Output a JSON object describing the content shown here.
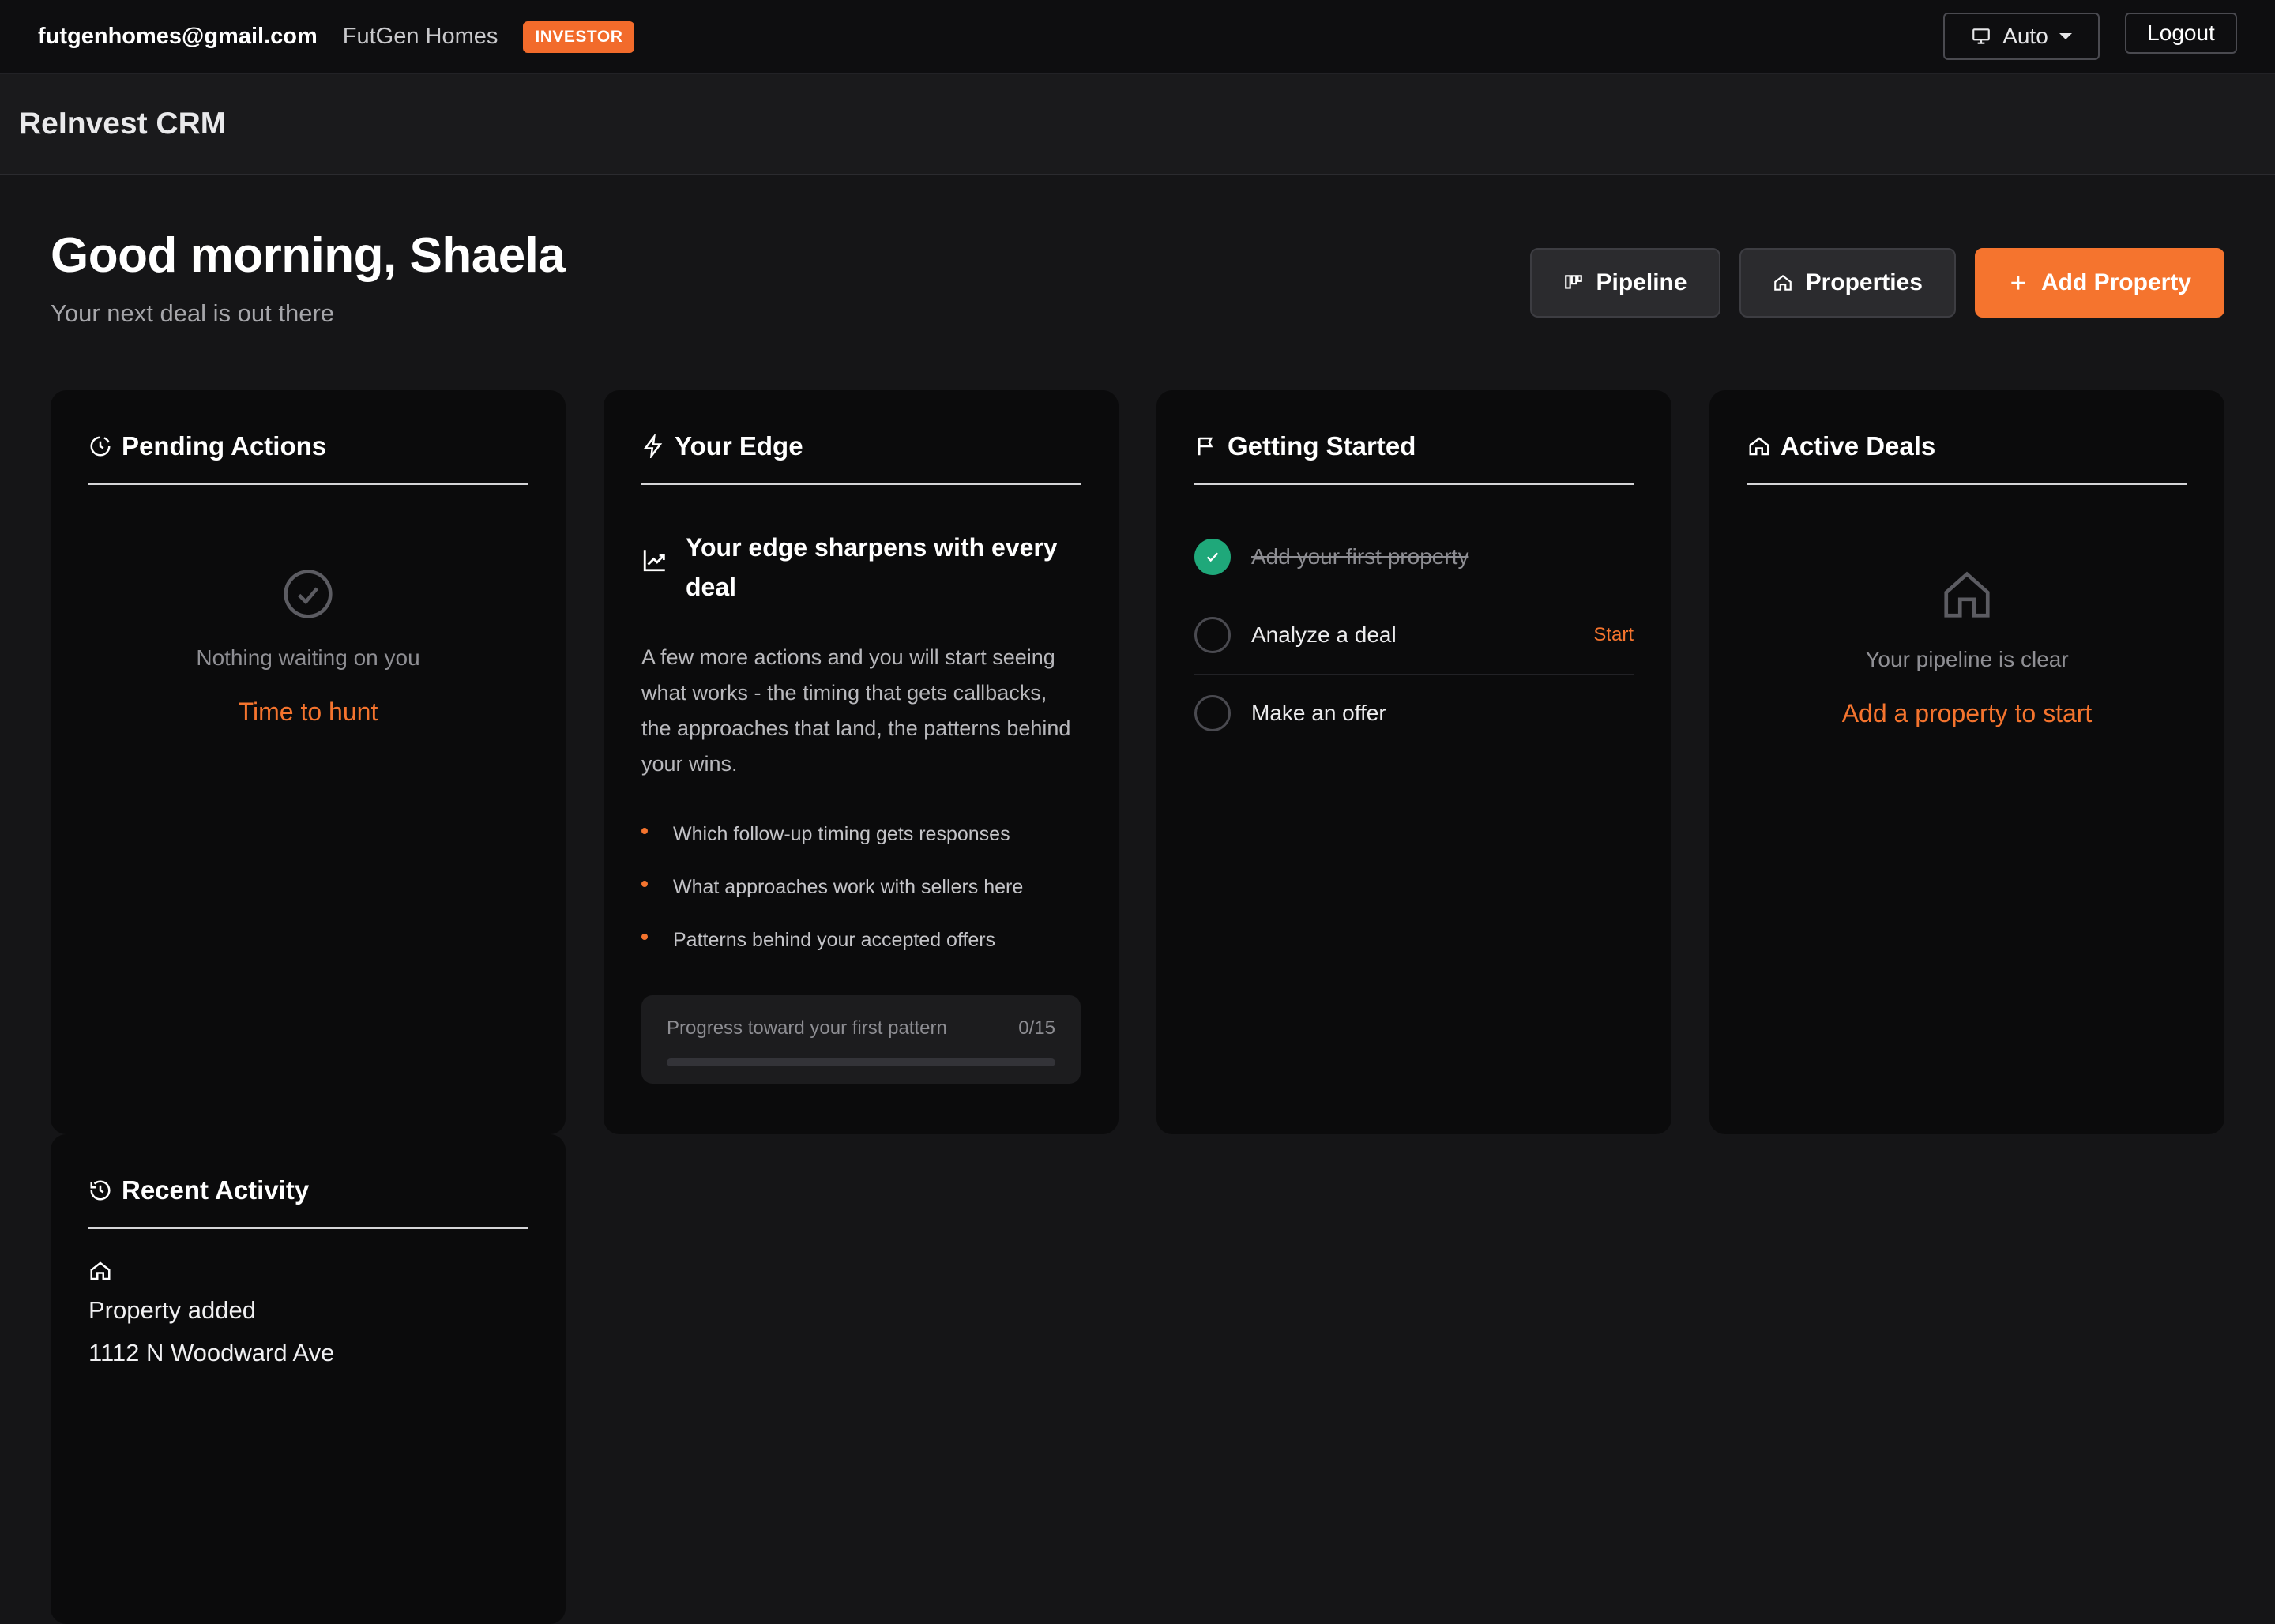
{
  "topbar": {
    "email": "futgenhomes@gmail.com",
    "company": "FutGen Homes",
    "role_badge": "INVESTOR",
    "theme": "Auto",
    "logout": "Logout"
  },
  "app": {
    "title": "ReInvest CRM"
  },
  "greeting": {
    "title": "Good morning, Shaela",
    "subtitle": "Your next deal is out there"
  },
  "actions": {
    "pipeline": "Pipeline",
    "properties": "Properties",
    "add_property": "Add Property"
  },
  "pending": {
    "title": "Pending Actions",
    "empty_message": "Nothing waiting on you",
    "link": "Time to hunt"
  },
  "edge": {
    "title": "Your Edge",
    "heading": "Your edge sharpens with every deal",
    "description": "A few more actions and you will start seeing what works - the timing that gets callbacks, the approaches that land, the patterns behind your wins.",
    "bullets": [
      "Which follow-up timing gets responses",
      "What approaches work with sellers here",
      "Patterns behind your accepted offers"
    ],
    "progress_label": "Progress toward your first pattern",
    "progress_text": "0/15",
    "progress_fraction": 0
  },
  "getting_started": {
    "title": "Getting Started",
    "steps": [
      {
        "label": "Add your first property",
        "done": true
      },
      {
        "label": "Analyze a deal",
        "done": false,
        "action": "Start"
      },
      {
        "label": "Make an offer",
        "done": false
      }
    ]
  },
  "active_deals": {
    "title": "Active Deals",
    "empty_message": "Your pipeline is clear",
    "link": "Add a property to start"
  },
  "recent_activity": {
    "title": "Recent Activity",
    "items": [
      {
        "type": "Property added",
        "detail": "1112 N Woodward Ave"
      }
    ]
  },
  "colors": {
    "accent": "#f5742e",
    "success": "#1fa87a",
    "background": "#151517",
    "card": "#0b0b0c"
  }
}
